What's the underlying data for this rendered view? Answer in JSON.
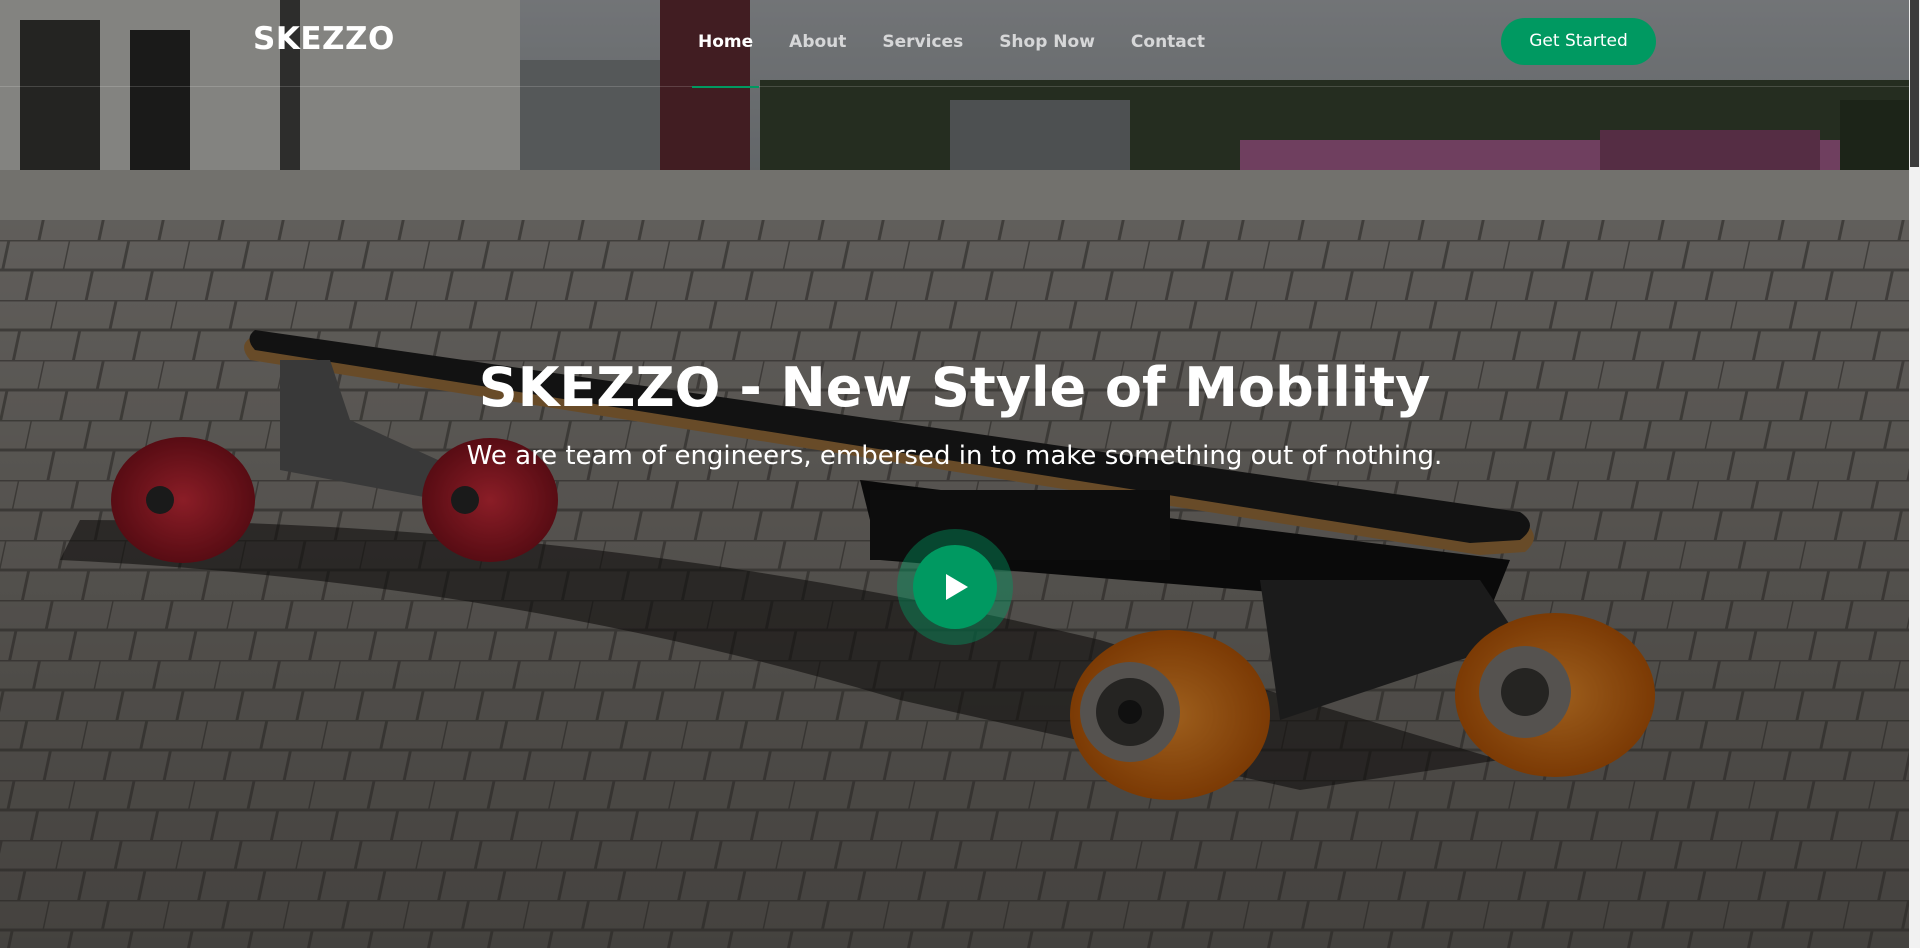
{
  "brand": {
    "logo_text": "SKEZZO"
  },
  "nav": {
    "items": [
      "Home",
      "About",
      "Services",
      "Shop Now",
      "Contact"
    ],
    "active": "Home"
  },
  "header": {
    "cta_label": "Get Started"
  },
  "hero": {
    "title": "SKEZZO - New Style of Mobility",
    "subtitle": "We are team of engineers, embersed in to make something out of nothing.",
    "background_image": "longboard-on-paving-stones",
    "play_icon": "play-icon"
  },
  "colors": {
    "accent": "#009961",
    "text": "#ffffff",
    "nav_inactive": "#c4c4c4"
  }
}
